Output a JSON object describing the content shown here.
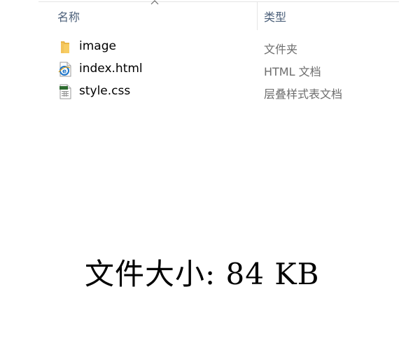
{
  "explorer": {
    "columns": {
      "name": "名称",
      "type": "类型"
    },
    "sort_icon": "chevron-up-icon",
    "files": [
      {
        "name": "image",
        "type": "文件夹",
        "icon": "folder-icon"
      },
      {
        "name": "index.html",
        "type": "HTML 文档",
        "icon": "html-document-icon"
      },
      {
        "name": "style.css",
        "type": "层叠样式表文档",
        "icon": "css-document-icon"
      }
    ]
  },
  "caption": {
    "text": "文件大小: 84 KB"
  },
  "colors": {
    "header_text": "#4c607a",
    "type_text": "#6d6d6d",
    "folder": "#f3c35a",
    "html_icon": "#1c74c9",
    "css_icon_bar": "#2c6b2f"
  }
}
